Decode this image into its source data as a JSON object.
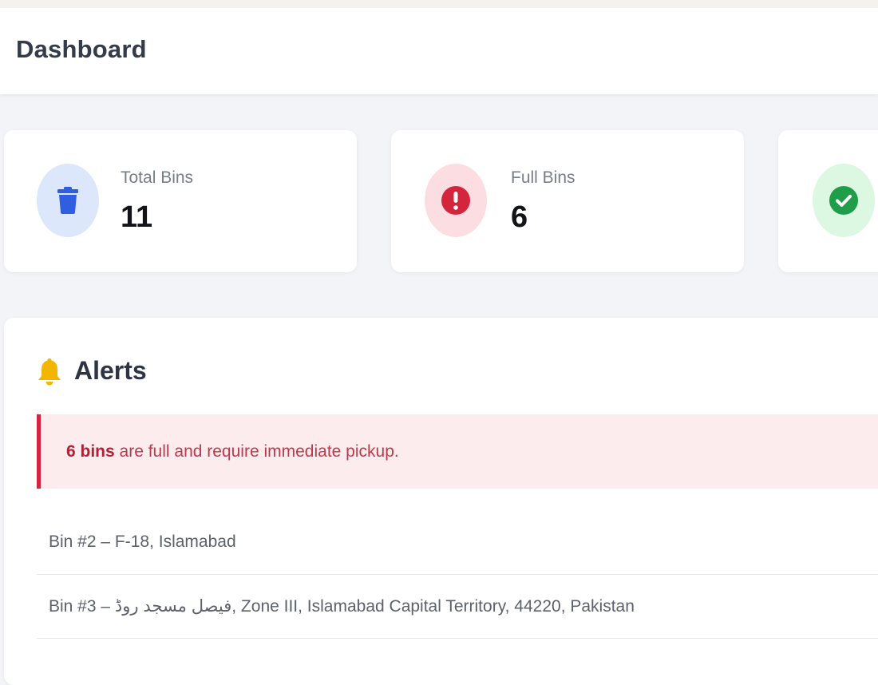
{
  "header": {
    "title": "Dashboard"
  },
  "cards": [
    {
      "label": "Total Bins",
      "value": "11",
      "icon": "trash-icon",
      "accent": "#2f5fe0"
    },
    {
      "label": "Full Bins",
      "value": "6",
      "icon": "alert-circle-icon",
      "accent": "#d3263c"
    },
    {
      "label": "",
      "value": "",
      "icon": "check-circle-icon",
      "accent": "#1f9d48"
    }
  ],
  "alerts": {
    "title": "Alerts",
    "icon": "bell-icon",
    "banner": {
      "count_text": "6 bins",
      "message": " are full and require immediate pickup."
    },
    "items": [
      {
        "text": "Bin #2 – F-18, Islamabad"
      },
      {
        "text": "Bin #3 – فیصل مسجد روڈ, Zone III, Islamabad Capital Territory, 44220, Pakistan"
      }
    ]
  }
}
